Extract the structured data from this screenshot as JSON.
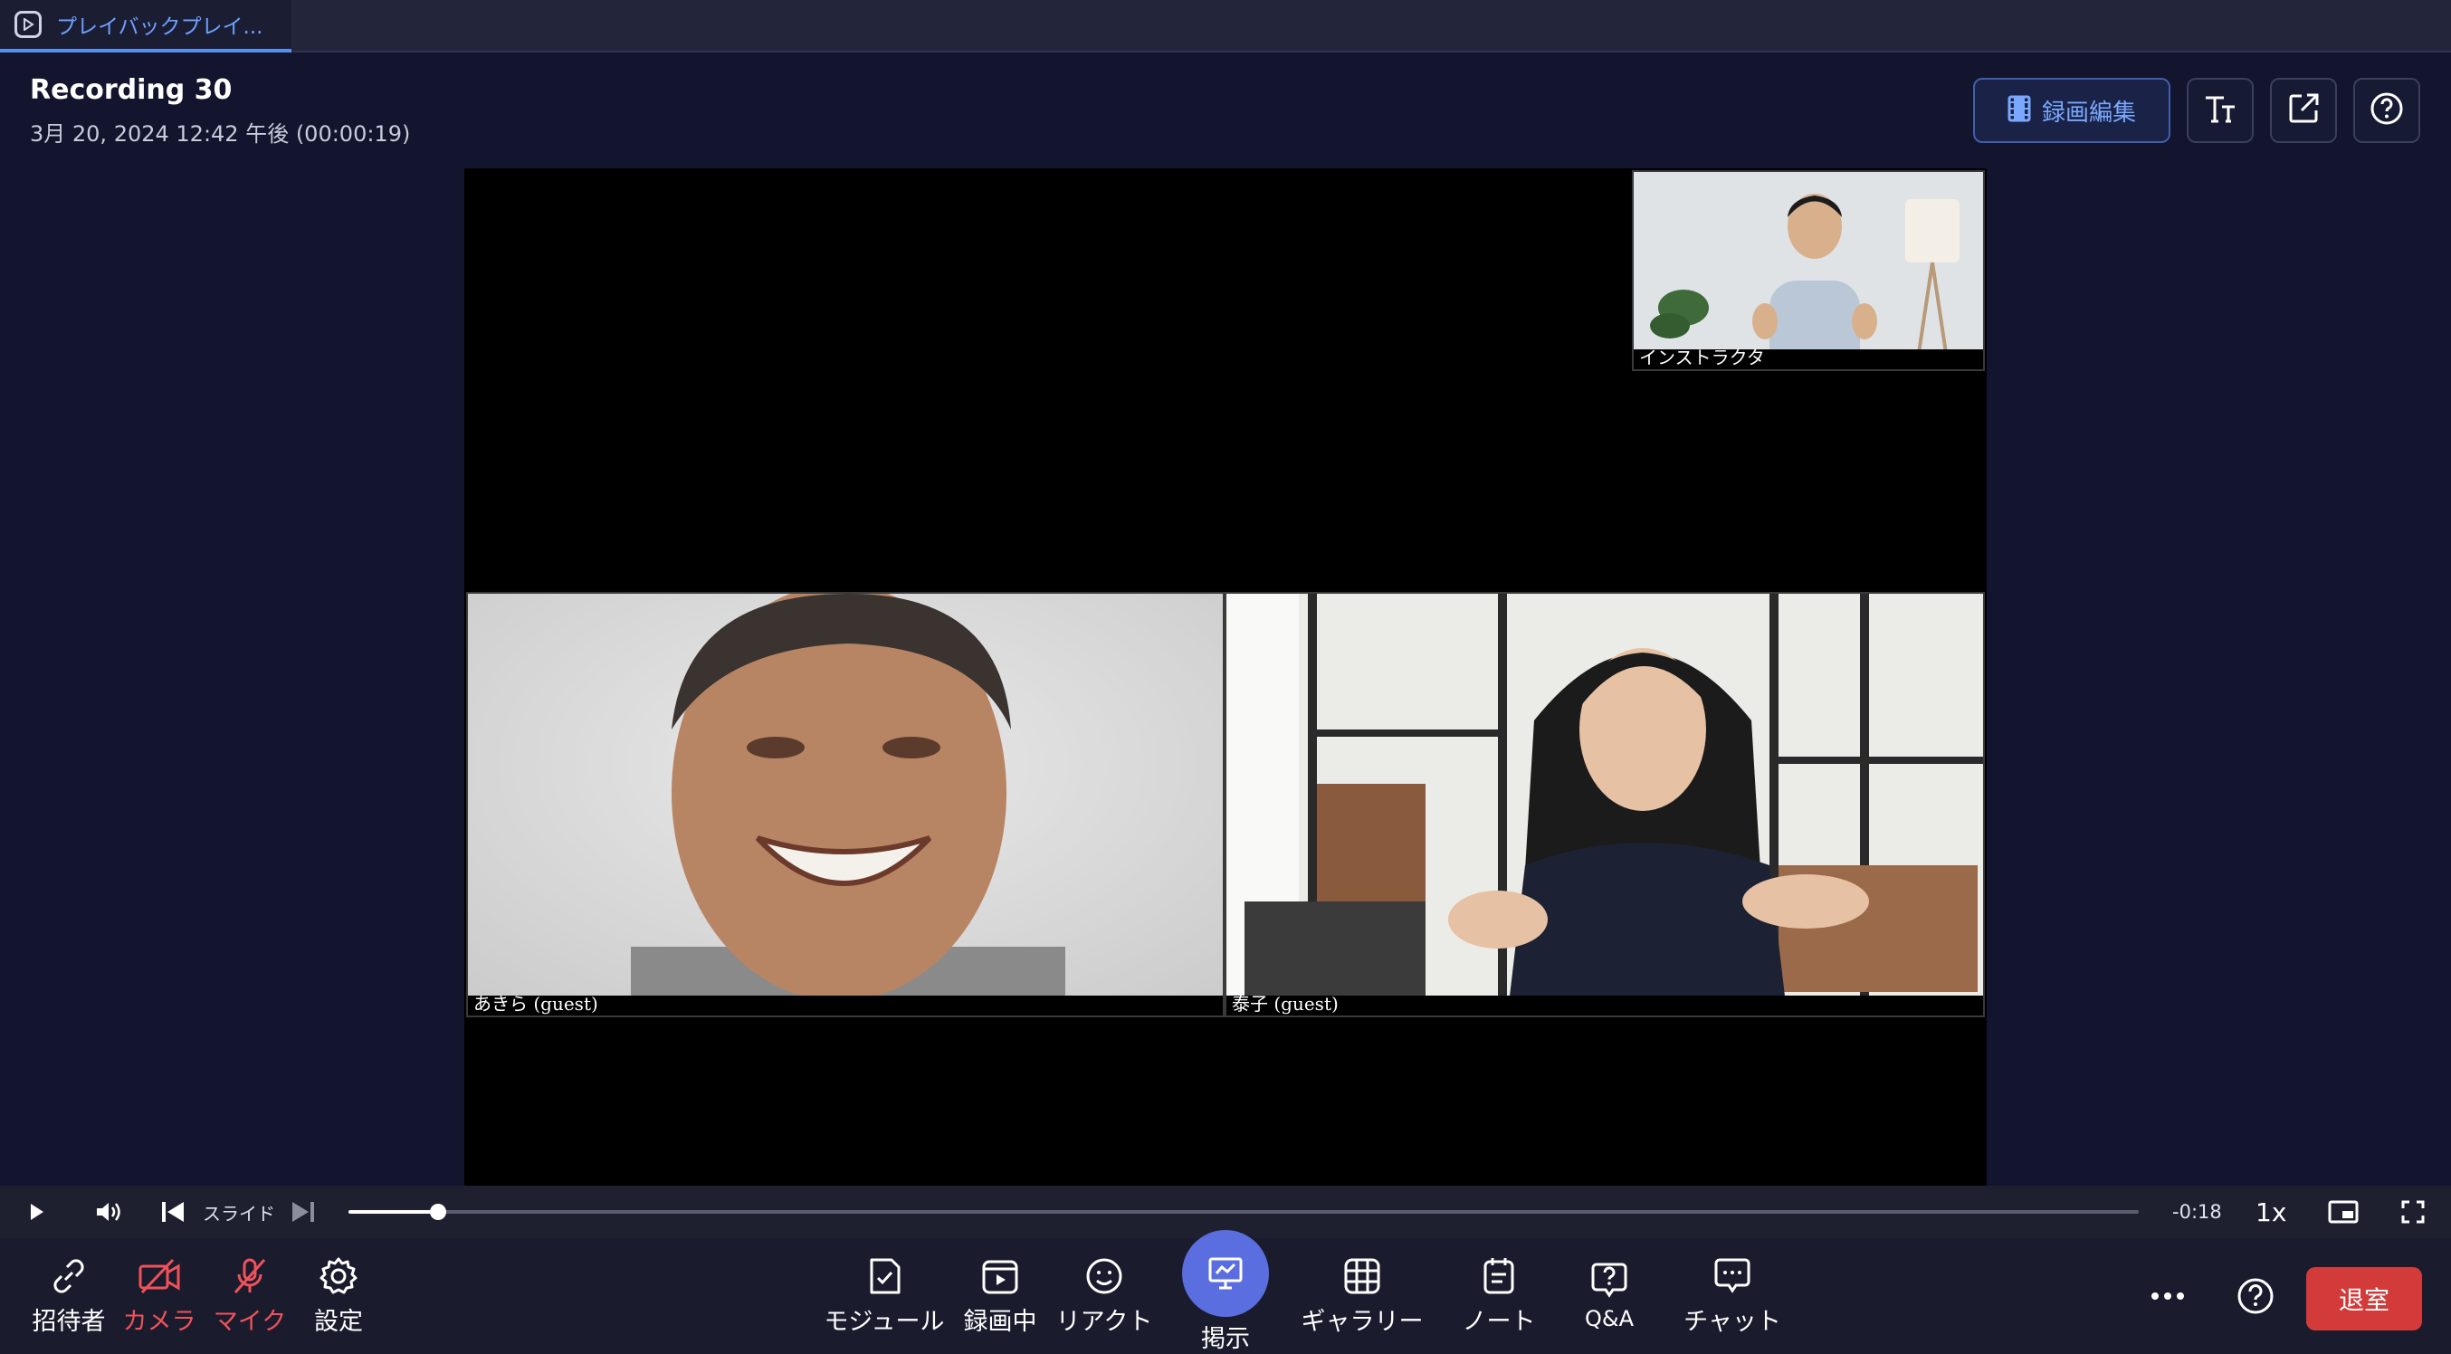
{
  "tab": {
    "label": "プレイバックプレイ..."
  },
  "recording": {
    "title": "Recording 30",
    "subtitle": "3月 20, 2024 12:42 午後 (00:00:19)"
  },
  "header": {
    "edit_label": "録画編集"
  },
  "participants": [
    {
      "name": "インストラクタ"
    },
    {
      "name": "あきら (guest)"
    },
    {
      "name": "泰子 (guest)"
    }
  ],
  "player": {
    "slide_label": "スライド",
    "progress": 0.05,
    "remaining": "-0:18",
    "speed": "1x"
  },
  "toolbar": {
    "invite": "招待者",
    "camera": "カメラ",
    "mic": "マイク",
    "settings": "設定",
    "module": "モジュール",
    "recording": "録画中",
    "react": "リアクト",
    "present": "掲示",
    "gallery": "ギャラリー",
    "notes": "ノート",
    "qa": "Q&A",
    "chat": "チャット",
    "leave": "退室"
  },
  "colors": {
    "accent": "#5b8def",
    "danger": "#d33a3a",
    "muted_red": "#f0525a",
    "present": "#5b6ee0"
  }
}
